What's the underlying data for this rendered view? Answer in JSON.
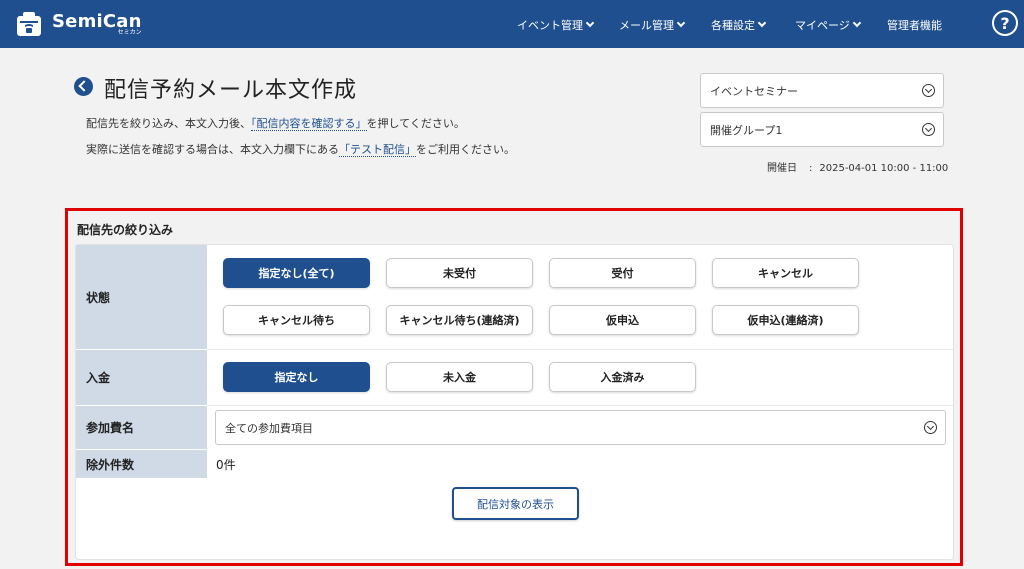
{
  "header": {
    "logo_name": "SemiCan",
    "logo_sub": "セミカン",
    "nav": [
      {
        "label": "イベント管理",
        "has_dropdown": true
      },
      {
        "label": "メール管理",
        "has_dropdown": true
      },
      {
        "label": "各種設定",
        "has_dropdown": true
      },
      {
        "label": "マイページ",
        "has_dropdown": true
      },
      {
        "label": "管理者機能",
        "has_dropdown": false
      }
    ],
    "help": "?"
  },
  "page": {
    "title": "配信予約メール本文作成",
    "desc1_pre": "配信先を絞り込み、本文入力後、",
    "desc1_hl": "「配信内容を確認する」",
    "desc1_post": "を押してください。",
    "desc2_pre": "実際に送信を確認する場合は、本文入力欄下にある",
    "desc2_hl": "「テスト配信」",
    "desc2_post": "をご利用ください。"
  },
  "selectors": {
    "event": "イベントセミナー",
    "group": "開催グループ1",
    "date_label": "開催日",
    "date_value": "2025-04-01 10:00 - 11:00"
  },
  "filter": {
    "title": "配信先の絞り込み",
    "status_label": "状態",
    "status_options": [
      "指定なし(全て)",
      "未受付",
      "受付",
      "キャンセル",
      "キャンセル待ち",
      "キャンセル待ち(連絡済)",
      "仮申込",
      "仮申込(連絡済)"
    ],
    "payment_label": "入金",
    "payment_options": [
      "指定なし",
      "未入金",
      "入金済み"
    ],
    "fee_label": "参加費名",
    "fee_value": "全ての参加費項目",
    "exclude_label": "除外件数",
    "exclude_value": "0件",
    "show_button": "配信対象の表示"
  },
  "colors": {
    "header_bg": "#1f4f8f",
    "accent": "#1f4f8f",
    "highlight_border": "#e00000",
    "label_bg": "#cfdae6"
  }
}
